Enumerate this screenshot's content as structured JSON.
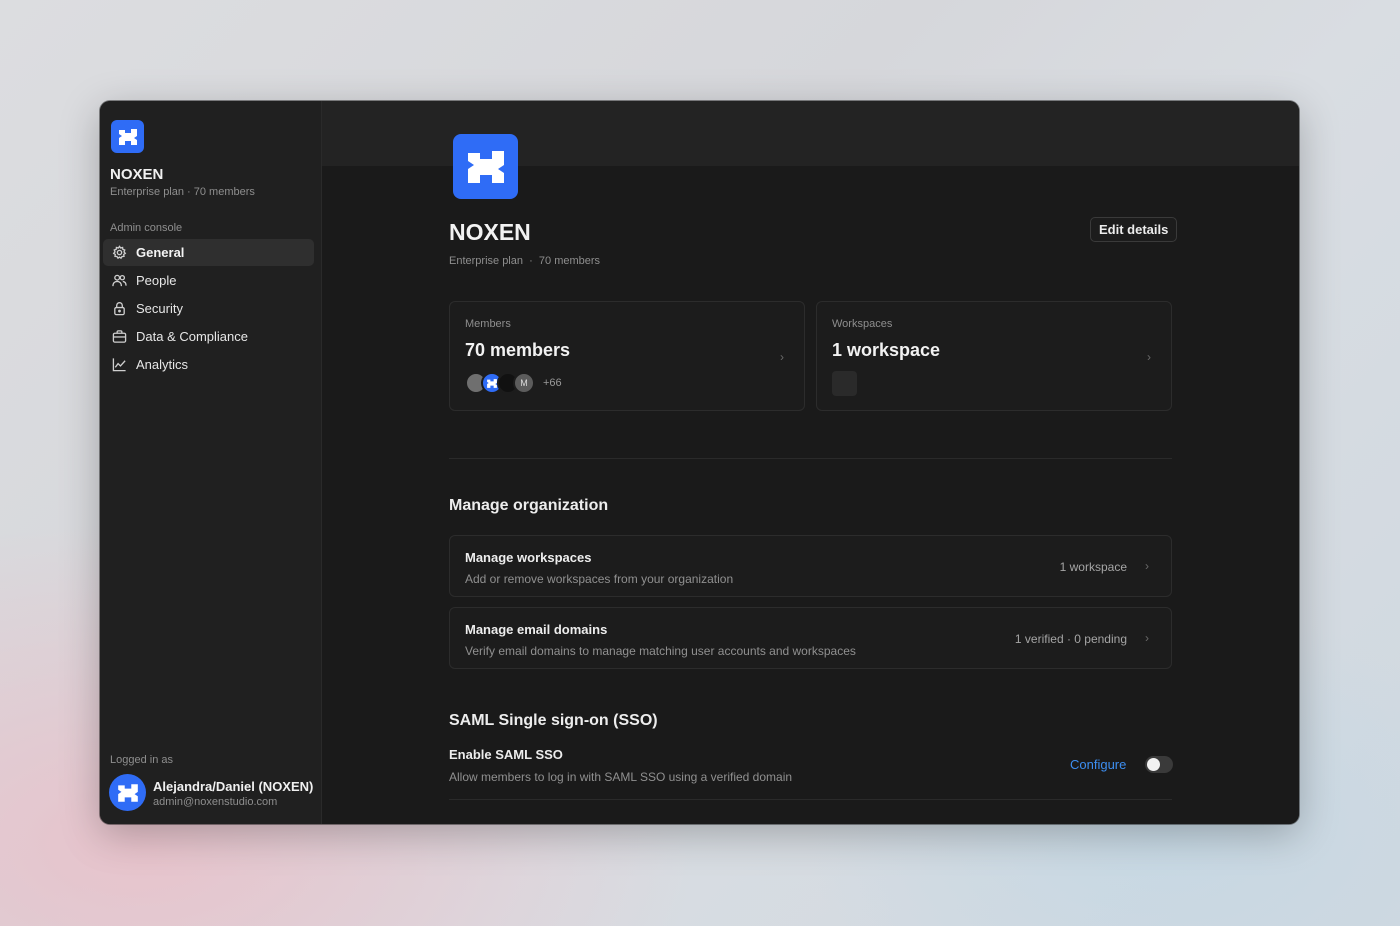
{
  "colors": {
    "accent": "#2f6cf6",
    "link": "#3d8ef0",
    "background": "#191919"
  },
  "sidebar": {
    "org_name": "NOXEN",
    "org_sub": "Enterprise plan · 70 members",
    "section_label": "Admin console",
    "items": [
      {
        "label": "General",
        "icon": "gear-icon",
        "active": true
      },
      {
        "label": "People",
        "icon": "people-icon",
        "active": false
      },
      {
        "label": "Security",
        "icon": "lock-icon",
        "active": false
      },
      {
        "label": "Data & Compliance",
        "icon": "briefcase-icon",
        "active": false
      },
      {
        "label": "Analytics",
        "icon": "chart-icon",
        "active": false
      }
    ],
    "logged_in_label": "Logged in as",
    "user_name": "Alejandra/Daniel (NOXEN)",
    "user_email": "admin@noxenstudio.com"
  },
  "header": {
    "title": "NOXEN",
    "plan": "Enterprise plan",
    "separator": "·",
    "members": "70 members",
    "edit_label": "Edit details"
  },
  "stats": {
    "members": {
      "label": "Members",
      "value": "70 members",
      "avatar_initial": "M",
      "more": "+66"
    },
    "workspaces": {
      "label": "Workspaces",
      "value": "1 workspace"
    }
  },
  "manage": {
    "title": "Manage organization",
    "rows": [
      {
        "title": "Manage workspaces",
        "desc": "Add or remove workspaces from your organization",
        "right": "1 workspace"
      },
      {
        "title": "Manage email domains",
        "desc": "Verify email domains to manage matching user accounts and workspaces",
        "right": "1 verified · 0 pending"
      }
    ]
  },
  "sso": {
    "title": "SAML Single sign-on (SSO)",
    "enable_title": "Enable SAML SSO",
    "enable_desc": "Allow members to log in with SAML SSO using a verified domain",
    "configure_label": "Configure",
    "enabled": false
  }
}
